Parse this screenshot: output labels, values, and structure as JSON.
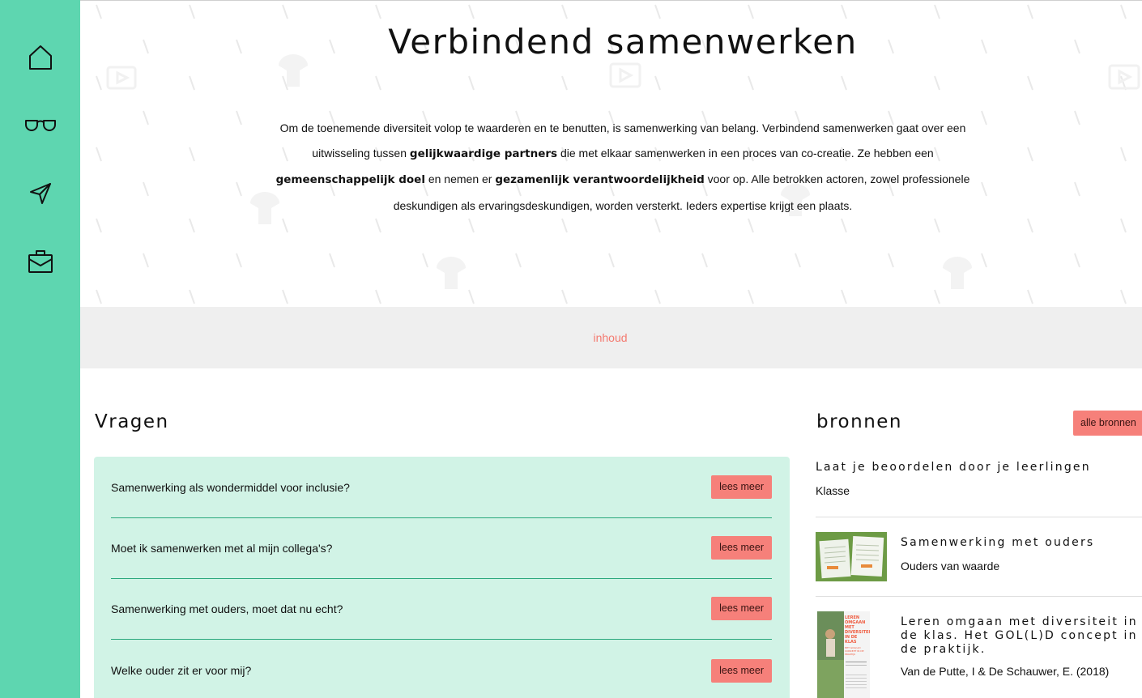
{
  "sidebar": {
    "items": [
      {
        "icon": "home-icon"
      },
      {
        "icon": "glasses-icon"
      },
      {
        "icon": "send-icon"
      },
      {
        "icon": "briefcase-icon"
      }
    ]
  },
  "hero": {
    "title": "Verbindend samenwerken",
    "intro": {
      "p1": "Om de toenemende diversiteit volop te waarderen en te benutten, is samenwerking van belang. Verbindend samenwerken gaat over een uitwisseling tussen ",
      "b1": "gelijkwaardige partners",
      "p2": " die met elkaar samenwerken in een proces van co-creatie. Ze hebben een ",
      "b2": "gemeenschappelijk doel",
      "p3": " en nemen er ",
      "b3": "gezamenlijk verantwoordelijkheid",
      "p4": " voor op. Alle betrokken actoren, zowel professionele deskundigen als ervaringsdeskundigen, worden versterkt. Ieders expertise krijgt een plaats."
    }
  },
  "inhoud": {
    "label": "inhoud"
  },
  "vragen": {
    "title": "Vragen",
    "items": [
      {
        "question": "Samenwerking als wondermiddel voor inclusie?",
        "button": "lees meer"
      },
      {
        "question": "Moet ik samenwerken met al mijn collega's?",
        "button": "lees meer"
      },
      {
        "question": "Samenwerking met ouders, moet dat nu echt?",
        "button": "lees meer"
      },
      {
        "question": "Welke ouder zit er voor mij?",
        "button": "lees meer"
      }
    ]
  },
  "bronnen": {
    "title": "bronnen",
    "all_button": "alle bronnen",
    "items": [
      {
        "title": "Laat je beoordelen door je leerlingen",
        "sub": "Klasse"
      },
      {
        "title": "Samenwerking met ouders",
        "sub": "Ouders van waarde"
      },
      {
        "title": "Leren omgaan met diversiteit in de klas. Het GOL(L)D concept in de praktijk.",
        "sub": "Van de Putte, I & De Schauwer, E. (2018)"
      }
    ],
    "book_cover": {
      "lines": [
        "LEREN",
        "OMGAAN",
        "MET DIVERSITEIT",
        "IN DE KLAS"
      ],
      "subtitle": "HET GOL(L)D CONCEPT IN DE PRAKTIJK"
    }
  },
  "colors": {
    "sidebar": "#5ed6b0",
    "accent": "#f6807a",
    "link": "#f47a70",
    "vragen_bg": "#d1f3e6",
    "divider": "#2aa87c",
    "band": "#efefef"
  }
}
